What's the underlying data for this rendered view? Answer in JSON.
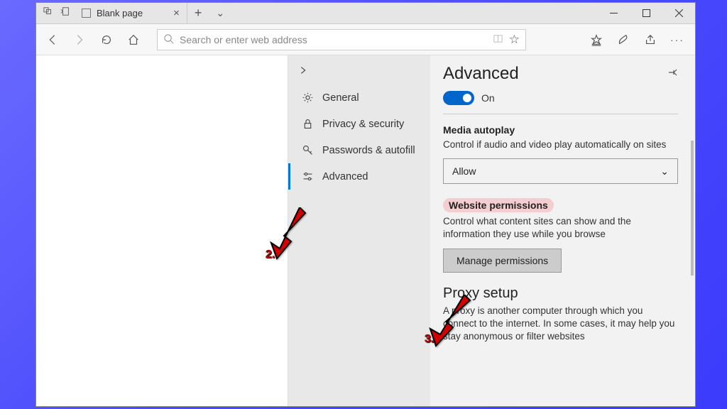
{
  "titlebar": {
    "tab_title": "Blank page"
  },
  "navbar": {
    "placeholder": "Search or enter web address"
  },
  "settings": {
    "nav": {
      "items": [
        {
          "label": "General"
        },
        {
          "label": "Privacy & security"
        },
        {
          "label": "Passwords & autofill"
        },
        {
          "label": "Advanced"
        }
      ]
    },
    "heading": "Advanced",
    "toggle_label": "On",
    "media": {
      "title": "Media autoplay",
      "desc": "Control if audio and video play automatically on sites",
      "select_value": "Allow"
    },
    "permissions": {
      "title": "Website permissions",
      "desc": "Control what content sites can show and the information they use while you browse",
      "button": "Manage permissions"
    },
    "proxy": {
      "title": "Proxy setup",
      "desc": "A proxy is another computer through which you connect to the internet. In some cases, it may help you stay anonymous or filter websites"
    }
  },
  "annotations": {
    "arrow2": "2.",
    "arrow3": "3."
  }
}
